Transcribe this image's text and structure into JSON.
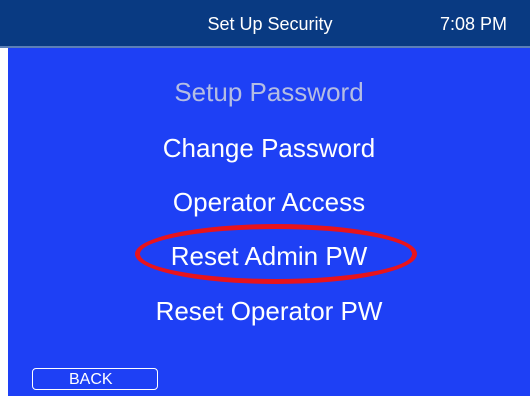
{
  "header": {
    "title": "Set Up Security",
    "time": "7:08 PM"
  },
  "menu": {
    "items": [
      {
        "label": "Setup Password",
        "enabled": false
      },
      {
        "label": "Change Password",
        "enabled": true
      },
      {
        "label": "Operator Access",
        "enabled": true
      },
      {
        "label": "Reset Admin PW",
        "enabled": true,
        "highlighted": true
      },
      {
        "label": "Reset Operator PW",
        "enabled": true
      }
    ]
  },
  "footer": {
    "back_label": "BACK"
  },
  "colors": {
    "header_bg": "#093a82",
    "panel_bg": "#1e40f5",
    "highlight": "#e8131c",
    "disabled_text": "#b4bde3"
  }
}
